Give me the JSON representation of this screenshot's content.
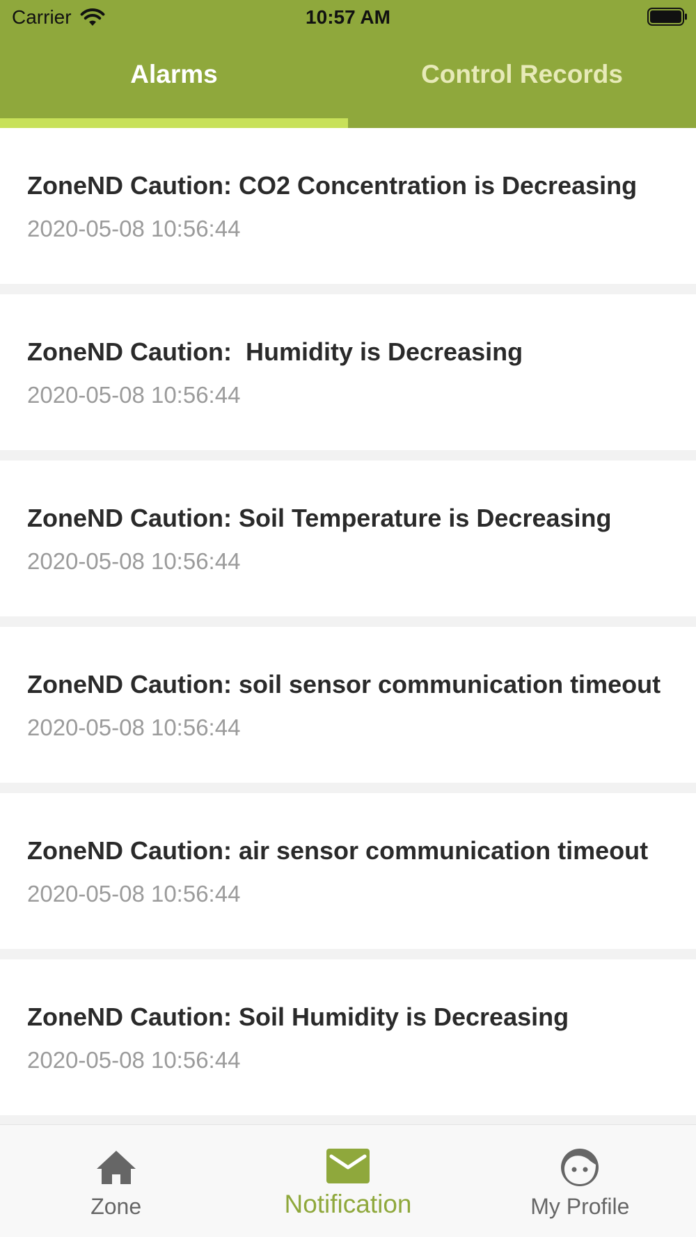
{
  "status_bar": {
    "carrier": "Carrier",
    "time": "10:57 AM"
  },
  "tabs": [
    {
      "label": "Alarms",
      "active": true
    },
    {
      "label": "Control Records",
      "active": false
    }
  ],
  "alarms": [
    {
      "title": "ZoneND Caution: CO2 Concentration is Decreasing",
      "time": "2020-05-08 10:56:44"
    },
    {
      "title": "ZoneND Caution:  Humidity is Decreasing",
      "time": "2020-05-08 10:56:44"
    },
    {
      "title": "ZoneND Caution: Soil Temperature is Decreasing",
      "time": "2020-05-08 10:56:44"
    },
    {
      "title": "ZoneND Caution: soil sensor communication timeout",
      "time": "2020-05-08 10:56:44"
    },
    {
      "title": "ZoneND Caution: air sensor communication timeout",
      "time": "2020-05-08 10:56:44"
    },
    {
      "title": "ZoneND Caution: Soil Humidity is Decreasing",
      "time": "2020-05-08 10:56:44"
    }
  ],
  "tabbar": [
    {
      "label": "Zone",
      "icon": "home-icon",
      "active": false
    },
    {
      "label": "Notification",
      "icon": "mail-icon",
      "active": true
    },
    {
      "label": "My Profile",
      "icon": "face-icon",
      "active": false
    }
  ],
  "colors": {
    "header": "#8fa83c",
    "tab_indicator": "#c8e15a",
    "active_tab_text": "#ffffff",
    "inactive_tab_text": "#e7eab8",
    "tabbar_active": "#8fa83c",
    "tabbar_inactive": "#666666"
  }
}
